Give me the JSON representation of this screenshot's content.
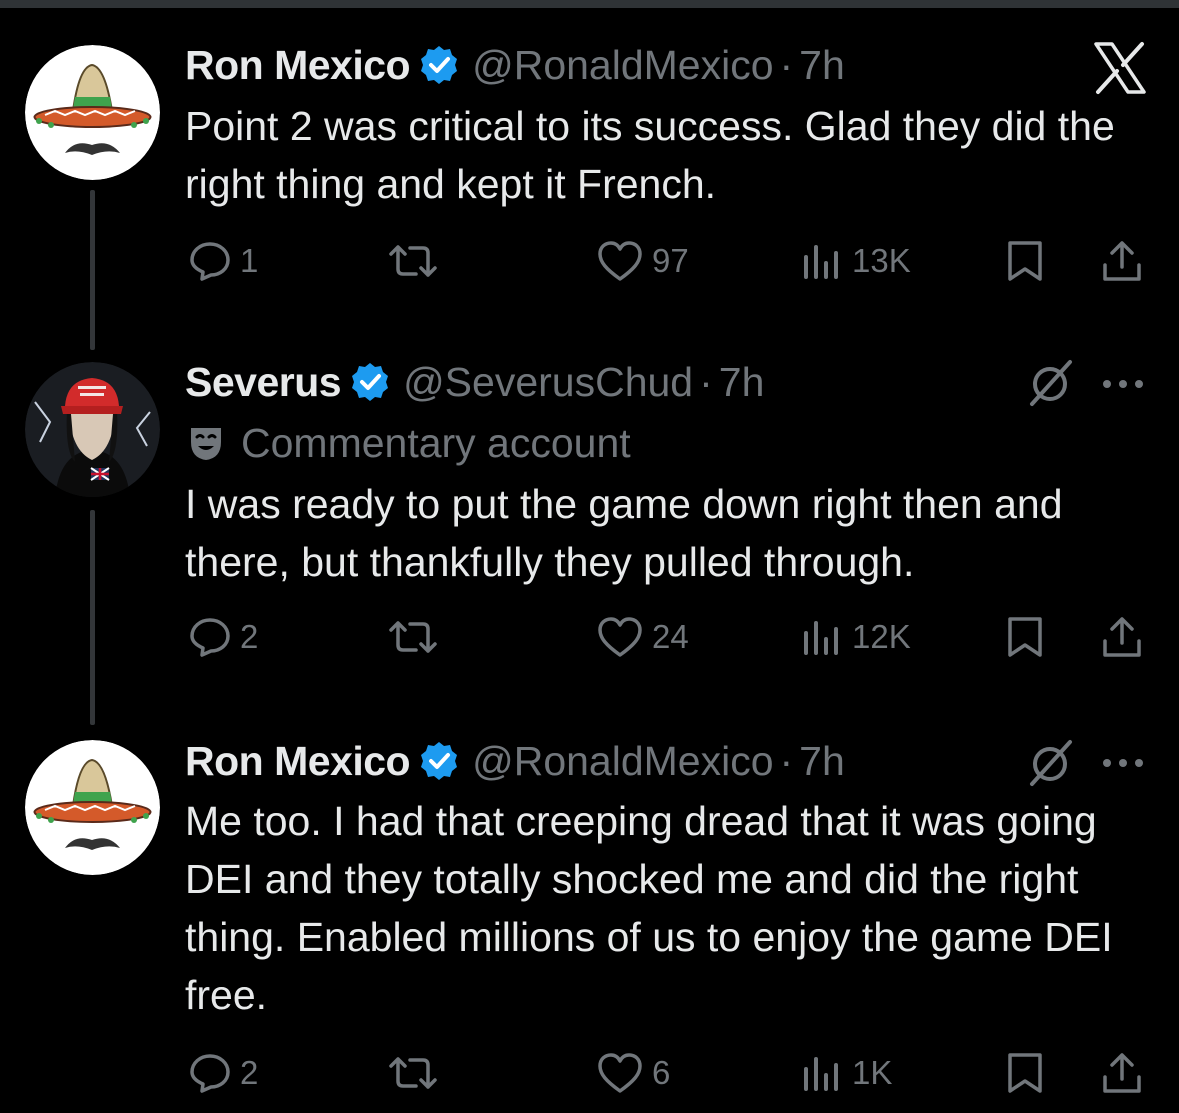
{
  "tweets": [
    {
      "name": "Ron Mexico",
      "handle": "@RonaldMexico",
      "separator": "·",
      "time": "7h",
      "text": "Point 2 was critical to its success. Glad they did the right thing and kept it French.",
      "replies": "1",
      "likes": "97",
      "views": "13K",
      "avatar": "sombrero-mustache-avatar",
      "label": null
    },
    {
      "name": "Severus",
      "handle": "@SeverusChud",
      "separator": "·",
      "time": "7h",
      "label": "Commentary account",
      "text": "I was ready to put the game down right then and there, but thankfully they pulled through.",
      "replies": "2",
      "likes": "24",
      "views": "12K",
      "avatar": "red-cap-portrait-avatar"
    },
    {
      "name": "Ron Mexico",
      "handle": "@RonaldMexico",
      "separator": "·",
      "time": "7h",
      "text": "Me too. I had that creeping dread that it was going DEI and they totally shocked me and did the right thing. Enabled millions of us to enjoy the game DEI free.",
      "replies": "2",
      "likes": "6",
      "views": "1K",
      "avatar": "sombrero-mustache-avatar",
      "label": null
    }
  ],
  "colors": {
    "background": "#000000",
    "primary_text": "#e7e9ea",
    "secondary_text": "#71767b",
    "verified_blue": "#1d9bf0",
    "thread_line": "#333639"
  },
  "icons": [
    "x-logo-icon",
    "verified-badge-icon",
    "reply-icon",
    "retweet-icon",
    "like-icon",
    "views-icon",
    "bookmark-icon",
    "share-icon",
    "grok-slash-icon",
    "more-icon",
    "theater-mask-icon"
  ]
}
